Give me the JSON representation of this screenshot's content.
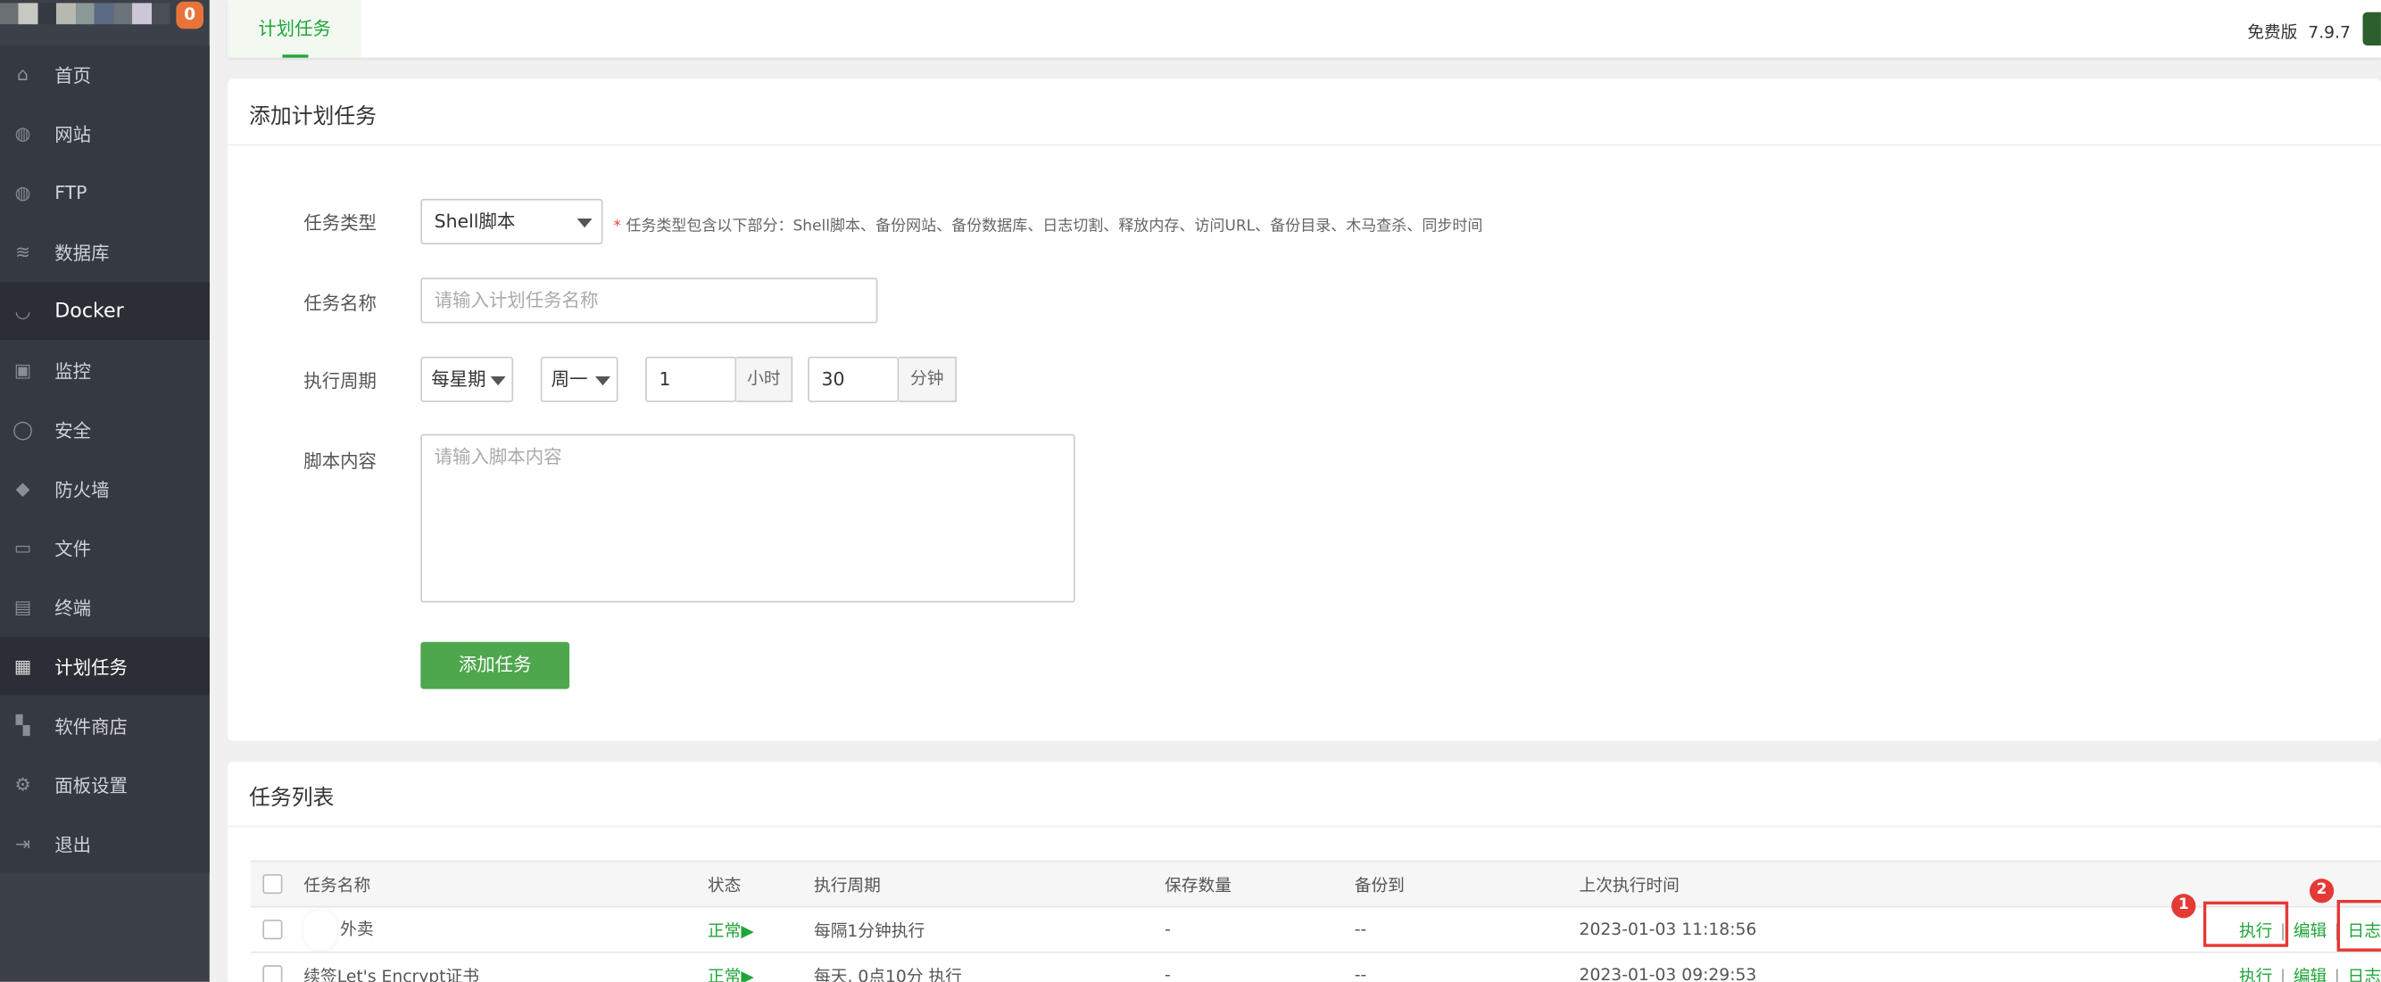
{
  "sidebar": {
    "notification_count": "0",
    "items": [
      {
        "label": "首页",
        "icon": "home-icon"
      },
      {
        "label": "网站",
        "icon": "globe-icon"
      },
      {
        "label": "FTP",
        "icon": "ftp-icon"
      },
      {
        "label": "数据库",
        "icon": "database-icon"
      },
      {
        "label": "Docker",
        "icon": "docker-icon"
      },
      {
        "label": "监控",
        "icon": "monitor-icon"
      },
      {
        "label": "安全",
        "icon": "shield-icon"
      },
      {
        "label": "防火墙",
        "icon": "firewall-icon"
      },
      {
        "label": "文件",
        "icon": "folder-icon"
      },
      {
        "label": "终端",
        "icon": "terminal-icon"
      },
      {
        "label": "计划任务",
        "icon": "calendar-icon",
        "active": true
      },
      {
        "label": "软件商店",
        "icon": "grid-icon"
      },
      {
        "label": "面板设置",
        "icon": "gear-icon"
      },
      {
        "label": "退出",
        "icon": "logout-icon"
      }
    ]
  },
  "topbar": {
    "tab": "计划任务",
    "edition": "免费版",
    "version": "7.9.7"
  },
  "add_form": {
    "title": "添加计划任务",
    "task_type_label": "任务类型",
    "task_type_value": "Shell脚本",
    "task_type_hint": "任务类型包含以下部分：Shell脚本、备份网站、备份数据库、日志切割、释放内存、访问URL、备份目录、木马查杀、同步时间",
    "task_name_label": "任务名称",
    "task_name_placeholder": "请输入计划任务名称",
    "cycle_label": "执行周期",
    "cycle_type": "每星期",
    "cycle_day": "周一",
    "hour_value": "1",
    "hour_unit": "小时",
    "minute_value": "30",
    "minute_unit": "分钟",
    "script_label": "脚本内容",
    "script_placeholder": "请输入脚本内容",
    "submit": "添加任务"
  },
  "task_list": {
    "title": "任务列表",
    "columns": [
      "任务名称",
      "状态",
      "执行周期",
      "保存数量",
      "备份到",
      "上次执行时间"
    ],
    "rows": [
      {
        "name": "外卖",
        "status": "正常",
        "cycle": "每隔1分钟执行",
        "keep": "-",
        "backup": "--",
        "last_run": "2023-01-03 11:18:56"
      },
      {
        "name": "续签Let's Encrypt证书",
        "status": "正常",
        "cycle": "每天, 0点10分 执行",
        "keep": "-",
        "backup": "--",
        "last_run": "2023-01-03 09:29:53"
      }
    ],
    "actions": {
      "run": "执行",
      "edit": "编辑",
      "log": "日志"
    }
  },
  "annotations": [
    "1",
    "2"
  ],
  "colors": {
    "accent": "#20a53a",
    "sidebar": "#353941",
    "annotation": "#e53935"
  }
}
